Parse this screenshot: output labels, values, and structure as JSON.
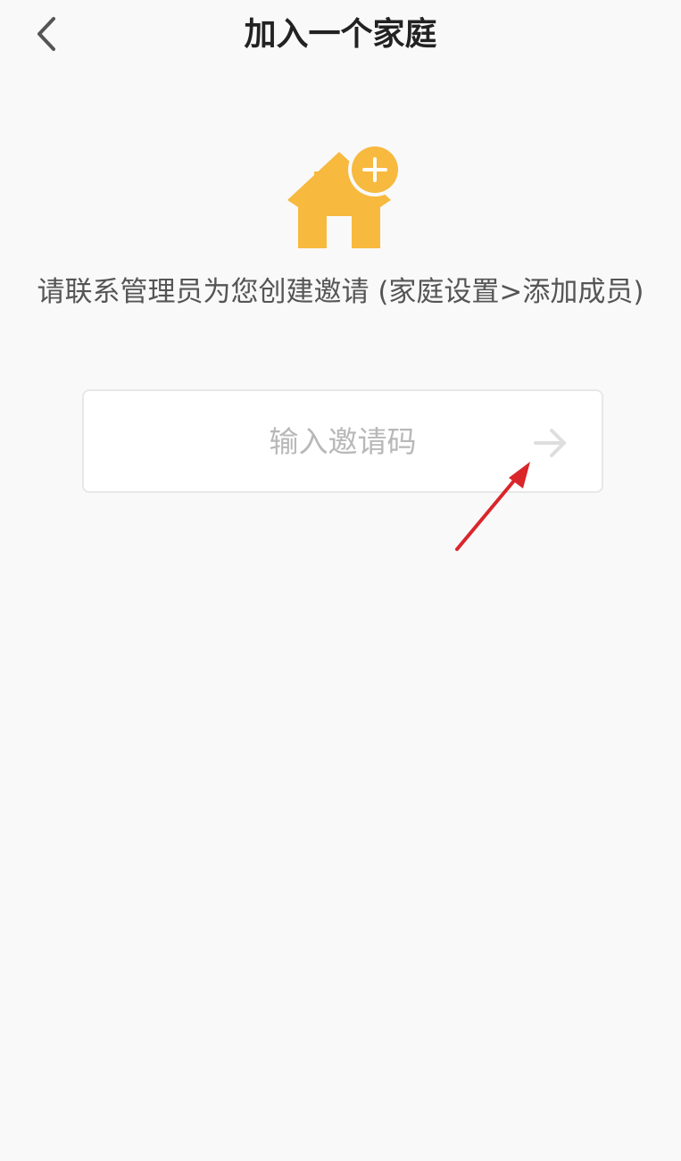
{
  "header": {
    "back_icon": "chevron-left-icon",
    "title": "加入一个家庭"
  },
  "hero": {
    "icon": "house-plus-icon",
    "icon_color": "#f7b93e"
  },
  "instruction": "请联系管理员为您创建邀请 (家庭设置>添加成员)",
  "invite": {
    "placeholder": "输入邀请码",
    "value": "",
    "submit_icon": "arrow-right-icon"
  },
  "annotation": {
    "icon": "red-pointer-arrow",
    "color": "#d9262b"
  }
}
